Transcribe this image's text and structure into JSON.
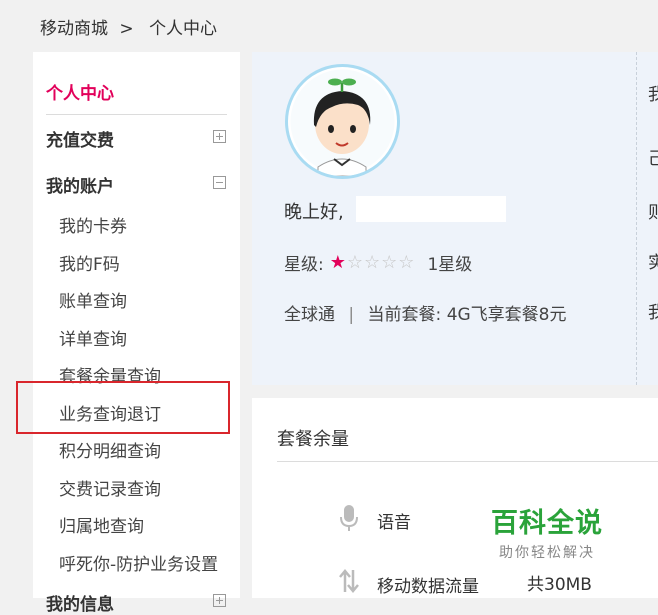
{
  "breadcrumb": {
    "home": "移动商城",
    "separator": ">",
    "current": "个人中心"
  },
  "sidebar": {
    "title": "个人中心",
    "categories": [
      {
        "label": "充值交费",
        "state": "collapsed"
      },
      {
        "label": "我的账户",
        "state": "expanded"
      },
      {
        "label": "我的信息",
        "state": "collapsed"
      }
    ],
    "account_items": [
      "我的卡券",
      "我的F码",
      "账单查询",
      "详单查询",
      "套餐余量查询",
      "业务查询退订",
      "积分明细查询",
      "交费记录查询",
      "归属地查询",
      "呼死你-防护业务设置"
    ]
  },
  "profile": {
    "greeting": "晚上好,",
    "star_label": "星级:",
    "star_level": 1,
    "star_max": 5,
    "star_text": "1星级",
    "brand": "全球通",
    "plan_separator": "|",
    "plan_label": "当前套餐:",
    "plan_name": "4G飞享套餐8元",
    "right_col": [
      "我",
      "己",
      "则",
      "实",
      "我"
    ]
  },
  "remaining": {
    "title": "套餐余量",
    "items": [
      {
        "label": "语音",
        "icon": "microphone-icon",
        "value": ""
      },
      {
        "label": "移动数据流量",
        "icon": "data-transfer-icon",
        "value": "共30MB"
      }
    ]
  },
  "watermark": {
    "main": "百科全说",
    "sub": "助你轻松解决"
  },
  "colors": {
    "accent": "#e2005a",
    "highlight_border": "#d9262c",
    "watermark": "#2aa33a"
  }
}
